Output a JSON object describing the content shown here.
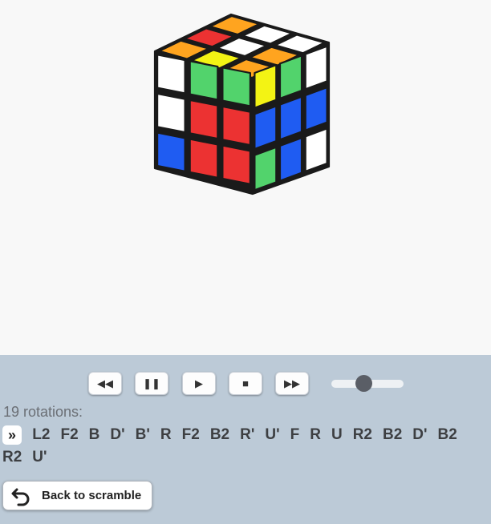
{
  "cube": {
    "colors": {
      "W": "#ffffff",
      "Y": "#f3f314",
      "R": "#ec3232",
      "O": "#ffa41f",
      "G": "#52d36c",
      "B": "#1f5cf2"
    },
    "faces": {
      "top": [
        [
          "O",
          "W",
          "W"
        ],
        [
          "R",
          "W",
          "O"
        ],
        [
          "O",
          "Y",
          "O"
        ]
      ],
      "left": [
        [
          "W",
          "G",
          "G"
        ],
        [
          "W",
          "R",
          "R"
        ],
        [
          "B",
          "R",
          "R"
        ]
      ],
      "right": [
        [
          "Y",
          "G",
          "W"
        ],
        [
          "B",
          "B",
          "B"
        ],
        [
          "G",
          "B",
          "W"
        ]
      ]
    }
  },
  "controls": {
    "buttons": [
      {
        "name": "rewind-button",
        "icon": "◀◀"
      },
      {
        "name": "pause-button",
        "icon": "❚❚"
      },
      {
        "name": "play-button",
        "icon": "▶"
      },
      {
        "name": "stop-button",
        "icon": "■"
      },
      {
        "name": "fast-forward-button",
        "icon": "▶▶"
      }
    ],
    "speed": 0.45
  },
  "solution": {
    "count_label": "19 rotations:",
    "current_marker": "»",
    "moves": [
      "L2",
      "F2",
      "B",
      "D'",
      "B'",
      "R",
      "F2",
      "B2",
      "R'",
      "U'",
      "F",
      "R",
      "U",
      "R2",
      "B2",
      "D'",
      "B2",
      "R2",
      "U'"
    ]
  },
  "back_button": {
    "label": "Back to scramble"
  }
}
